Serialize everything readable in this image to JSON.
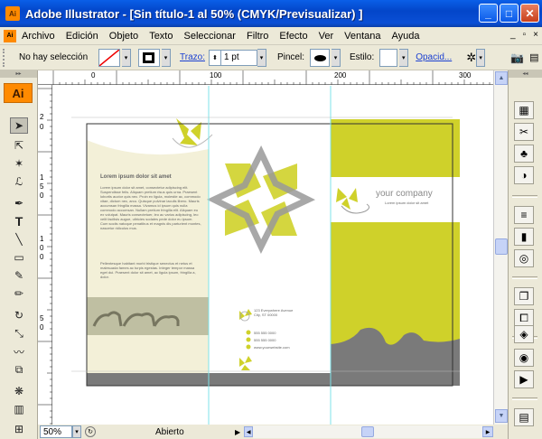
{
  "window": {
    "title": "Adobe Illustrator - [Sin título-1 al 50% (CMYK/Previsualizar) ]",
    "app_icon_label": "Ai",
    "minimize": "_",
    "maximize": "□",
    "close": "✕"
  },
  "menu": {
    "items": [
      "Archivo",
      "Edición",
      "Objeto",
      "Texto",
      "Seleccionar",
      "Filtro",
      "Efecto",
      "Ver",
      "Ventana",
      "Ayuda"
    ],
    "doc_controls": [
      "_",
      "▫",
      "×"
    ]
  },
  "control_bar": {
    "selection_label": "No hay selección",
    "stroke_label": "Trazo:",
    "stroke_weight": "1 pt",
    "brush_label": "Pincel:",
    "style_label": "Estilo:",
    "opacity_label": "Opacid..."
  },
  "toolbox": {
    "header": "▸▸",
    "logo": "Ai"
  },
  "right_panel": {
    "header": "◂◂"
  },
  "rulers": {
    "h_labels": [
      "0",
      "100",
      "200",
      "300"
    ],
    "v_labels": [
      "2",
      "0",
      "1",
      "5",
      "0",
      "1",
      "0",
      "0",
      "5",
      "0"
    ]
  },
  "brochure": {
    "heading": "Lorem ipsum dolor sit amet",
    "body1": "Lorem ipsum dolor sit amet, consectetur adipiscing elit. Suspendisse felis. Aliquam pretium risus quis urna. Praesent lobortis auctor quis nec. Proin ex ligula, molestie ac, commodo vitae, dictum nec, arcu. Quisque pulvinar iaculis libero. Mauris accumsan fringilla massa. Vivamus id ipsum quis nulla commodo accumsan. Nullam pretium fringilla elit. Aliquam eu ex volutpat. Mauris consectetuer, leo ac varius adipiscing, leo velit facilisis augue, ultricies sodales pede dolor eu ipsum. Cum sociis natoque penatibus et magnis dis parturient montes, nascetur ridiculus mus.",
    "body2": "Pellentesque habitant morbi tristique senectus et netus et malesuada fames ac turpis egestas. Integer tempor massa eget dui. Praesent dolor sit amet, ac ligula ipsum, fringilla a, dolor.",
    "address_line1": "123 Everywhere Avenue",
    "address_line2": "City, ST 00000",
    "phone": "555 555 0000",
    "fax": "555 555 0000",
    "web": "www.yourwebsite.com",
    "company": "your company",
    "tagline": "Lorem ipsum dolor sit amet"
  },
  "status": {
    "zoom": "50%",
    "state": "Abierto"
  },
  "colors": {
    "accent_yellow": "#cfd12a",
    "grey_panel": "#7a7a7a",
    "cream": "#f3f0d8",
    "guide_cyan": "#7fe3e8"
  }
}
